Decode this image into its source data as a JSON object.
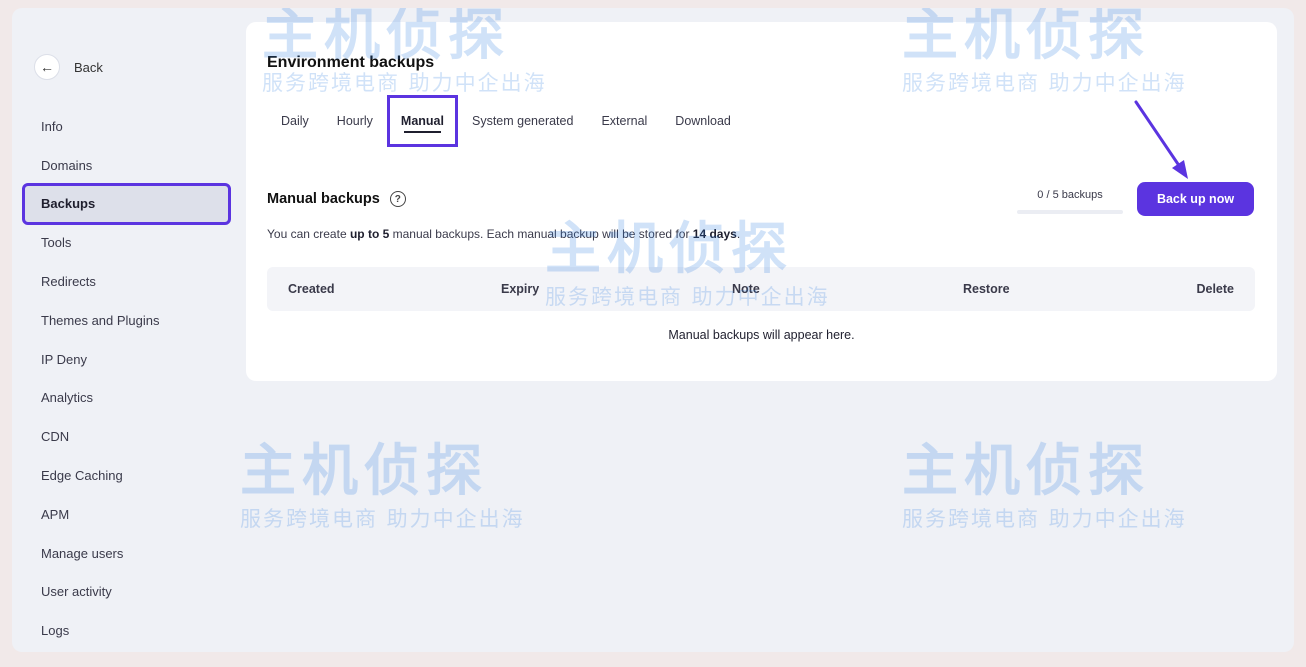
{
  "sidebar": {
    "back_label": "Back",
    "items": [
      {
        "label": "Info",
        "active": false
      },
      {
        "label": "Domains",
        "active": false
      },
      {
        "label": "Backups",
        "active": true
      },
      {
        "label": "Tools",
        "active": false
      },
      {
        "label": "Redirects",
        "active": false
      },
      {
        "label": "Themes and Plugins",
        "active": false
      },
      {
        "label": "IP Deny",
        "active": false
      },
      {
        "label": "Analytics",
        "active": false
      },
      {
        "label": "CDN",
        "active": false
      },
      {
        "label": "Edge Caching",
        "active": false
      },
      {
        "label": "APM",
        "active": false
      },
      {
        "label": "Manage users",
        "active": false
      },
      {
        "label": "User activity",
        "active": false
      },
      {
        "label": "Logs",
        "active": false
      }
    ]
  },
  "main": {
    "title": "Environment backups",
    "tabs": [
      {
        "label": "Daily",
        "active": false
      },
      {
        "label": "Hourly",
        "active": false
      },
      {
        "label": "Manual",
        "active": true
      },
      {
        "label": "System generated",
        "active": false
      },
      {
        "label": "External",
        "active": false
      },
      {
        "label": "Download",
        "active": false
      }
    ],
    "section": {
      "title": "Manual backups",
      "desc_prefix": "You can create ",
      "desc_bold_1": "up to 5",
      "desc_middle": " manual backups. Each manual backup will be stored for ",
      "desc_bold_2": "14 days",
      "desc_suffix": "."
    },
    "quota": {
      "text": "0 / 5 backups",
      "used": 0,
      "max": 5
    },
    "primary_button": "Back up now",
    "table": {
      "columns": [
        "Created",
        "Expiry",
        "Note",
        "Restore",
        "Delete"
      ],
      "empty_message": "Manual backups will appear here."
    }
  },
  "watermark": {
    "title": "主机侦探",
    "subtitle": "服务跨境电商 助力中企出海"
  },
  "colors": {
    "accent": "#5b34e0",
    "background": "#eff1f6",
    "card": "#ffffff"
  }
}
